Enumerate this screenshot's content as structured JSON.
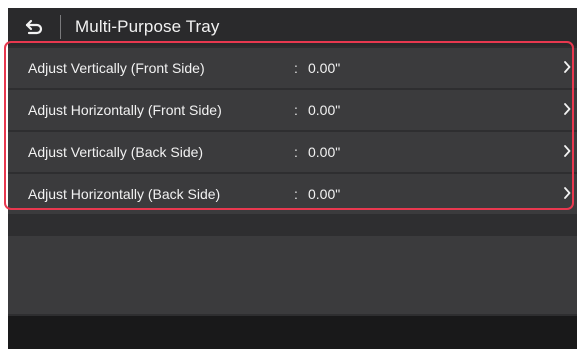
{
  "header": {
    "title": "Multi-Purpose Tray",
    "back_icon": "back-arrow-icon"
  },
  "list": {
    "items": [
      {
        "label": "Adjust Vertically (Front Side)",
        "separator": ":",
        "value": "0.00\"",
        "icon": "chevron-right-icon"
      },
      {
        "label": "Adjust Horizontally (Front Side)",
        "separator": ":",
        "value": "0.00\"",
        "icon": "chevron-right-icon"
      },
      {
        "label": "Adjust Vertically (Back Side)",
        "separator": ":",
        "value": "0.00\"",
        "icon": "chevron-right-icon"
      },
      {
        "label": "Adjust Horizontally (Back Side)",
        "separator": ":",
        "value": "0.00\"",
        "icon": "chevron-right-icon"
      }
    ]
  },
  "colors": {
    "background": "#2e2e30",
    "row": "#3b3b3d",
    "header": "#2a2a2c",
    "footer": "#19191a",
    "text": "#f2f2f2",
    "highlight": "#e8384f"
  }
}
